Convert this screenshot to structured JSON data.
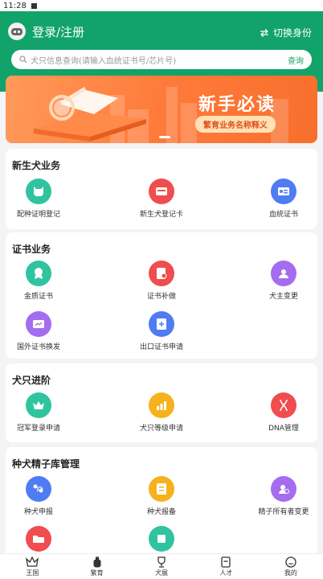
{
  "status": {
    "time": "11:28"
  },
  "header": {
    "login_label": "登录/注册",
    "switch_label": "切换身份"
  },
  "search": {
    "placeholder": "犬只信息查询(请输入血统证书号/芯片号)",
    "button": "查询"
  },
  "banner": {
    "title": "新手必读",
    "subtitle": "繁育业务名称释义"
  },
  "sections": [
    {
      "title": "新生犬业务",
      "items": [
        {
          "label": "配种证明登记",
          "color": "#2fc49f",
          "icon": "dog-face-icon"
        },
        {
          "label": "新生犬登记卡",
          "color": "#ef4d4f",
          "icon": "card-icon"
        },
        {
          "label": "血统证书",
          "color": "#4f7cf3",
          "icon": "id-card-icon"
        }
      ]
    },
    {
      "title": "证书业务",
      "items": [
        {
          "label": "金质证书",
          "color": "#2fc49f",
          "icon": "medal-icon"
        },
        {
          "label": "证书补做",
          "color": "#ef4d4f",
          "icon": "certificate-icon"
        },
        {
          "label": "犬主变更",
          "color": "#a56cf0",
          "icon": "owner-icon"
        },
        {
          "label": "国外证书换发",
          "color": "#a56cf0",
          "icon": "exchange-icon"
        },
        {
          "label": "出口证书申请",
          "color": "#4f7cf3",
          "icon": "export-icon"
        }
      ]
    },
    {
      "title": "犬只进阶",
      "items": [
        {
          "label": "冠军登录申请",
          "color": "#2fc49f",
          "icon": "crown-icon"
        },
        {
          "label": "犬只等级申请",
          "color": "#f5b21e",
          "icon": "bar-chart-icon"
        },
        {
          "label": "DNA管理",
          "color": "#ef4d4f",
          "icon": "dna-icon"
        }
      ]
    },
    {
      "title": "种犬精子库管理",
      "items": [
        {
          "label": "种犬申报",
          "color": "#4f7cf3",
          "icon": "sperm-icon"
        },
        {
          "label": "种犬报备",
          "color": "#f5b21e",
          "icon": "report-icon"
        },
        {
          "label": "精子所有者变更",
          "color": "#a56cf0",
          "icon": "transfer-icon"
        },
        {
          "label": "",
          "color": "#ef4d4f",
          "icon": "folder-icon"
        },
        {
          "label": "",
          "color": "#2fc49f",
          "icon": "box-icon"
        }
      ]
    }
  ],
  "tabbar": [
    {
      "label": "王国",
      "icon": "crown-icon"
    },
    {
      "label": "繁育",
      "icon": "bottle-icon"
    },
    {
      "label": "犬展",
      "icon": "trophy-icon"
    },
    {
      "label": "人才",
      "icon": "card-icon"
    },
    {
      "label": "我的",
      "icon": "smile-icon"
    }
  ]
}
